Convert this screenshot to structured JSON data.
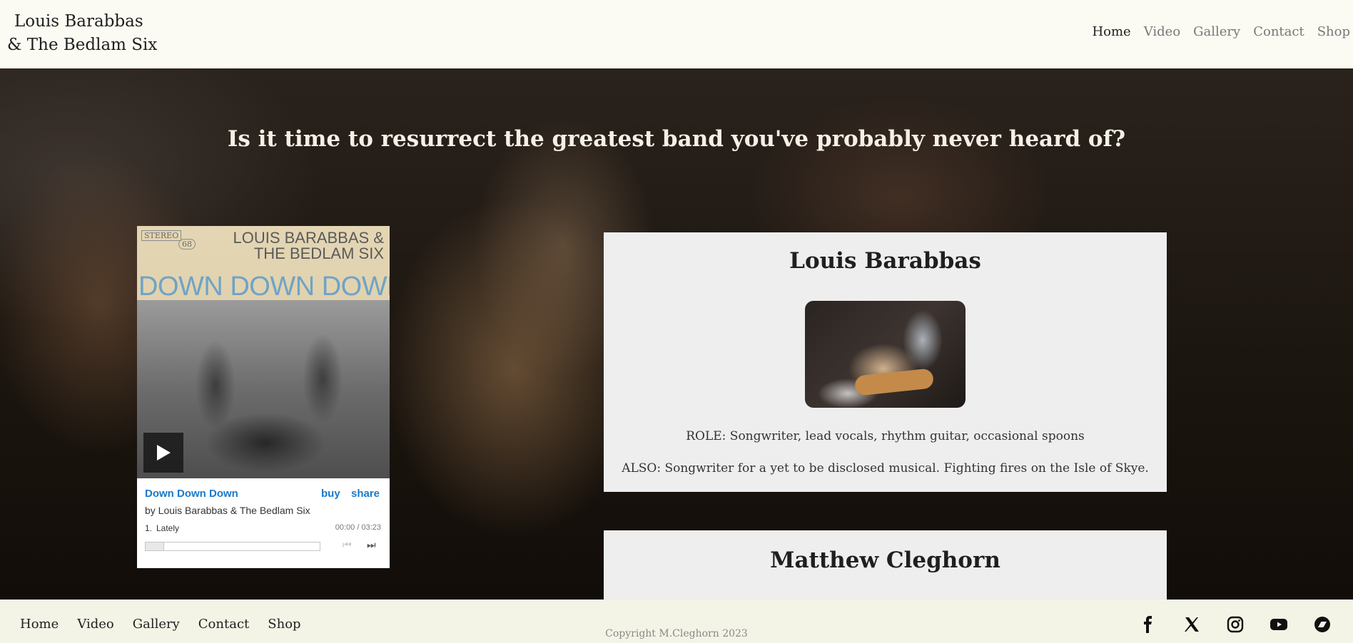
{
  "header": {
    "logo_line1": "Louis Barabbas",
    "logo_line2": "& The Bedlam Six",
    "nav": [
      "Home",
      "Video",
      "Gallery",
      "Contact",
      "Shop"
    ],
    "active": "Home"
  },
  "hero": {
    "title": "Is it time to resurrect the greatest band you've probably never heard of?"
  },
  "player": {
    "cover_stereo": "STEREO",
    "cover_number": "68",
    "cover_band": "LOUIS BARABBAS & THE BEDLAM SIX",
    "cover_album": "DOWN DOWN DOWN",
    "album_title": "Down Down Down",
    "buy_label": "buy",
    "share_label": "share",
    "artist": "by Louis Barabbas & The Bedlam Six",
    "track_number": "1.",
    "track_name": "Lately",
    "time": "00:00 / 03:23",
    "progress": 0.0
  },
  "cards": [
    {
      "name": "Louis Barabbas",
      "role": "ROLE: Songwriter, lead vocals, rhythm guitar, occasional spoons",
      "also": "ALSO: Songwriter for a yet to be disclosed musical. Fighting fires on the Isle of Skye."
    },
    {
      "name": "Matthew Cleghorn"
    }
  ],
  "footer": {
    "nav": [
      "Home",
      "Video",
      "Gallery",
      "Contact",
      "Shop"
    ],
    "copyright": "Copyright M.Cleghorn 2023",
    "social_icons": [
      "facebook-icon",
      "x-icon",
      "instagram-icon",
      "youtube-icon",
      "bandcamp-icon"
    ]
  }
}
